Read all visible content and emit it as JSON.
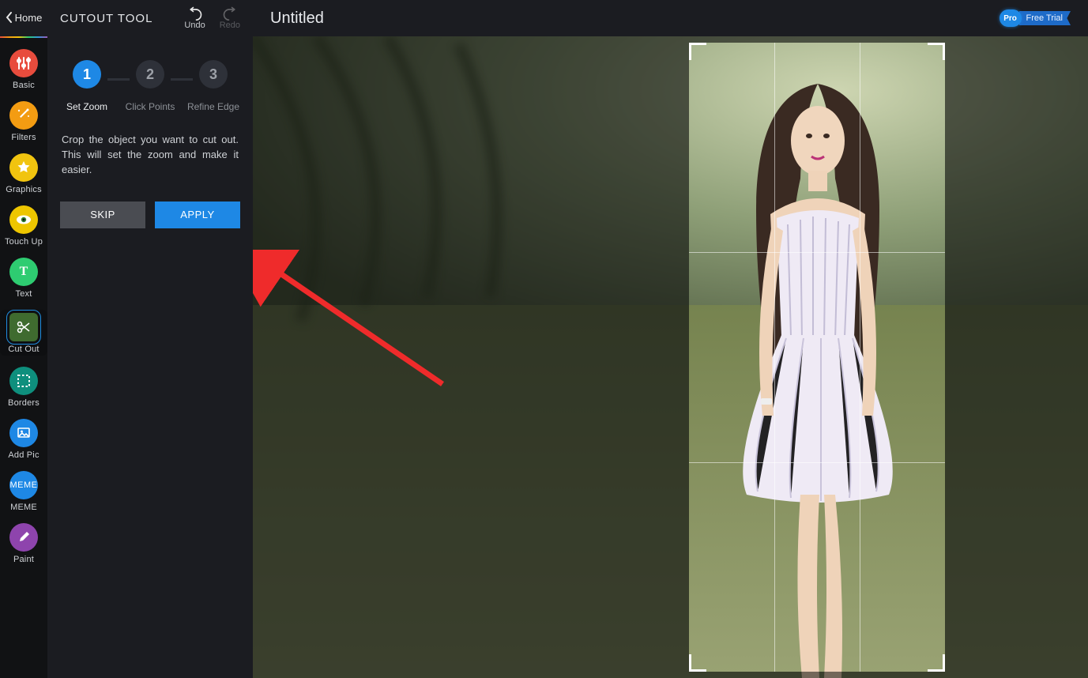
{
  "home_label": "Home",
  "nav": [
    {
      "label": "Basic",
      "icon": "sliders",
      "color": "c-red"
    },
    {
      "label": "Filters",
      "icon": "wand",
      "color": "c-orange"
    },
    {
      "label": "Graphics",
      "icon": "star",
      "color": "c-gold"
    },
    {
      "label": "Touch Up",
      "icon": "eye",
      "color": "c-eye"
    },
    {
      "label": "Text",
      "icon": "T",
      "color": "c-green"
    },
    {
      "label": "Cut Out",
      "icon": "scissors",
      "color": "c-olive",
      "active": true
    },
    {
      "label": "Borders",
      "icon": "frame",
      "color": "c-teal"
    },
    {
      "label": "Add Pic",
      "icon": "image",
      "color": "c-blue"
    },
    {
      "label": "MEME",
      "icon": "meme",
      "color": "c-meme"
    },
    {
      "label": "Paint",
      "icon": "brush",
      "color": "c-purple"
    }
  ],
  "panel_title": "CUTOUT TOOL",
  "undo_label": "Undo",
  "redo_label": "Redo",
  "steps": [
    {
      "num": "1",
      "label": "Set Zoom",
      "active": true
    },
    {
      "num": "2",
      "label": "Click Points"
    },
    {
      "num": "3",
      "label": "Refine Edge"
    }
  ],
  "help_text": "Crop the object you want to cut out. This will set the zoom and make it easier.",
  "skip_label": "SKIP",
  "apply_label": "APPLY",
  "doc_title": "Untitled",
  "pro_chip": "Pro",
  "pro_ribbon": "Free Trial"
}
